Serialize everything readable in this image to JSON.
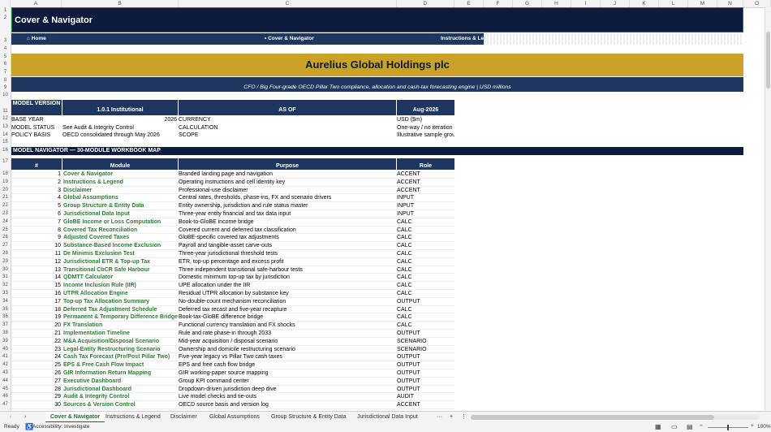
{
  "columns": [
    "A",
    "B",
    "C",
    "D",
    "E",
    "F",
    "G",
    "H",
    "I",
    "J",
    "K",
    "L",
    "M",
    "N",
    "O"
  ],
  "banner": {
    "title": "Cover & Navigator"
  },
  "nav": {
    "home": "⌂ Home",
    "current": "• Cover & Navigator",
    "next": "Instructions & Legend"
  },
  "company": {
    "name": "Aurelius Global Holdings plc",
    "subtitle": "CFO / Big Four-grade OECD Pillar Two compliance, allocation and cash-tax forecasting engine | USD millions"
  },
  "info": {
    "h1": "MODEL VERSION",
    "h2": "1.0.1 Institutional",
    "h3": "AS OF",
    "h4": "Aug-2026",
    "rows": [
      [
        "BASE YEAR",
        "2026",
        "CURRENCY",
        "USD ($m)"
      ],
      [
        "MODEL STATUS",
        "See Audit & Integrity Control",
        "CALCULATION",
        "One-way / no iteration"
      ],
      [
        "POLICY BASIS",
        "OECD consolidated through May 2026",
        "SCOPE",
        "Illustrative sample group"
      ]
    ]
  },
  "navigator": {
    "title": "MODEL NAVIGATOR — 30-MODULE WORKBOOK MAP",
    "headers": [
      "#",
      "Module",
      "Purpose",
      "Role"
    ],
    "rows": [
      [
        "1",
        "Cover & Navigator",
        "Branded landing page and navigation",
        "ACCENT"
      ],
      [
        "2",
        "Instructions & Legend",
        "Operating instructions and cell identity key",
        "ACCENT"
      ],
      [
        "3",
        "Disclaimer",
        "Professional-use disclaimer",
        "ACCENT"
      ],
      [
        "4",
        "Global Assumptions",
        "Central rates, thresholds, phase-ins, FX and scenario drivers",
        "INPUT"
      ],
      [
        "5",
        "Group Structure & Entity Data",
        "Entity ownership, jurisdiction and rule status master",
        "INPUT"
      ],
      [
        "6",
        "Jurisdictional Data Input",
        "Three-year entity financial and tax data input",
        "INPUT"
      ],
      [
        "7",
        "GloBE Income or Loss Computation",
        "Book-to-GloBE income bridge",
        "CALC"
      ],
      [
        "8",
        "Covered Tax Reconciliation",
        "Covered current and deferred tax classification",
        "CALC"
      ],
      [
        "9",
        "Adjusted Covered Taxes",
        "GloBE-specific covered tax adjustments",
        "CALC"
      ],
      [
        "10",
        "Substance-Based Income Exclusion",
        "Payroll and tangible-asset carve-outs",
        "CALC"
      ],
      [
        "11",
        "De Minimis Exclusion Test",
        "Three-year jurisdictional threshold tests",
        "CALC"
      ],
      [
        "12",
        "Jurisdictional ETR & Top-up Tax",
        "ETR, top-up percentage and excess profit",
        "CALC"
      ],
      [
        "13",
        "Transitional CbCR Safe Harbour",
        "Three independent transitional safe-harbour tests",
        "CALC"
      ],
      [
        "14",
        "QDMTT Calculator",
        "Domestic minimum top-up tax by jurisdiction",
        "CALC"
      ],
      [
        "15",
        "Income Inclusion Rule (IIR)",
        "UPE allocation under the IIR",
        "CALC"
      ],
      [
        "16",
        "UTPR Allocation Engine",
        "Residual UTPR allocation by substance key",
        "CALC"
      ],
      [
        "17",
        "Top-up Tax Allocation Summary",
        "No-double-count mechanism reconciliation",
        "OUTPUT"
      ],
      [
        "18",
        "Deferred Tax Adjustment Schedule",
        "Deferred tax recast and five-year recapture",
        "CALC"
      ],
      [
        "19",
        "Permanent & Temporary Difference Bridge",
        "Book-tax-GloBE difference bridge",
        "CALC"
      ],
      [
        "20",
        "FX Translation",
        "Functional currency translation and FX shocks",
        "CALC"
      ],
      [
        "21",
        "Implementation Timeline",
        "Rule and rate phase-in through 2033",
        "OUTPUT"
      ],
      [
        "22",
        "M&A Acquisition/Disposal Scenario",
        "Mid-year acquisition / disposal scenario",
        "SCENARIO"
      ],
      [
        "23",
        "Legal-Entity Restructuring Scenario",
        "Ownership and domicile restructuring scenario",
        "SCENARIO"
      ],
      [
        "24",
        "Cash Tax Forecast (Pre/Post Pillar Two)",
        "Five-year legacy vs Pillar Two cash taxes",
        "OUTPUT"
      ],
      [
        "25",
        "EPS & Free Cash Flow Impact",
        "EPS and free cash flow bridge",
        "OUTPUT"
      ],
      [
        "26",
        "GIR Information Return Mapping",
        "GIR working-paper source mapping",
        "OUTPUT"
      ],
      [
        "27",
        "Executive Dashboard",
        "Group KPI command center",
        "OUTPUT"
      ],
      [
        "28",
        "Jurisdictional Dashboard",
        "Dropdown-driven jurisdiction deep dive",
        "OUTPUT"
      ],
      [
        "29",
        "Audit & Integrity Control",
        "Live model checks and tie-outs",
        "AUDIT"
      ],
      [
        "30",
        "Sources & Version Control",
        "OECD source basis and version log",
        "ACCENT"
      ]
    ]
  },
  "tabs": [
    "Cover & Navigator",
    "Instructions & Legend",
    "Disclaimer",
    "Global Assumptions",
    "Group Structure & Entity Data",
    "Jurisdictional Data Input"
  ],
  "status": {
    "ready": "Ready",
    "accessibility": "Accessibility: Investigate",
    "zoom": "100%"
  },
  "colors": {
    "navy": "#1f3660",
    "darknavy": "#0d1b3d",
    "gold": "#c9a227",
    "green": "#2e7d32"
  }
}
